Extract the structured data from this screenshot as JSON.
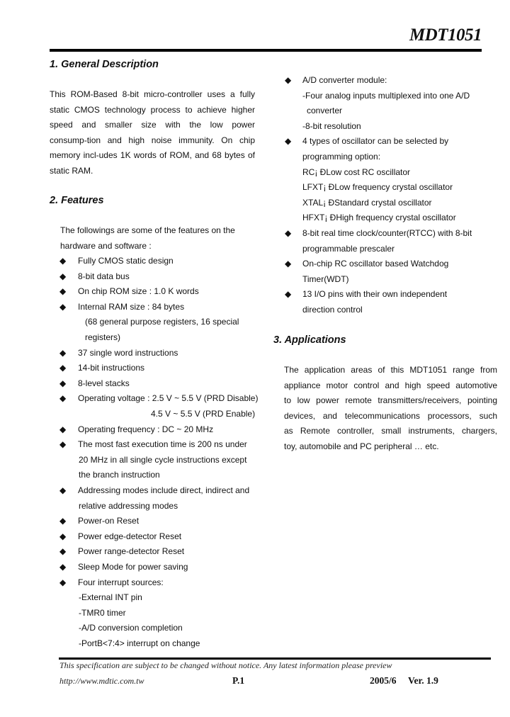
{
  "header": {
    "title": "MDT1051"
  },
  "sections": {
    "general": {
      "heading": "1. General Description",
      "lines": [
        "This ROM-Based 8-bit micro-controller uses a fully",
        "static CMOS technology process to achieve higher",
        "speed and smaller size with the low power",
        "consump-tion and high noise immunity. On chip",
        "memory incl-udes 1K words of ROM, and 68 bytes of",
        "static RAM."
      ]
    },
    "features": {
      "heading": "2. Features",
      "intro": [
        "The followings are some of the features on the",
        "hardware and software :"
      ],
      "bullet_glyph": "◆",
      "left_rows": [
        {
          "bullet": true,
          "text": "Fully CMOS static design"
        },
        {
          "bullet": true,
          "text": "8-bit data bus"
        },
        {
          "bullet": true,
          "text": "On chip ROM size : 1.0 K words"
        },
        {
          "bullet": true,
          "text": "Internal RAM size : 84 bytes"
        },
        {
          "bullet": false,
          "indent": 2,
          "text": "(68 general purpose registers, 16 special"
        },
        {
          "bullet": false,
          "indent": 2,
          "text": "registers)"
        },
        {
          "bullet": true,
          "text": "37 single word instructions"
        },
        {
          "bullet": true,
          "text": "14-bit instructions"
        },
        {
          "bullet": true,
          "text": "8-level stacks"
        },
        {
          "bullet": true,
          "text": "Operating voltage : 2.5 V ~ 5.5 V (PRD Disable)"
        },
        {
          "bullet": false,
          "indent": 3,
          "text": "4.5 V ~ 5.5 V (PRD Enable)"
        },
        {
          "bullet": true,
          "text": "Operating frequency : DC ~ 20 MHz"
        },
        {
          "bullet": true,
          "text": "The most fast execution time is 200 ns under"
        },
        {
          "bullet": false,
          "indent": 1,
          "text": "20 MHz in all single  cycle instructions except"
        },
        {
          "bullet": false,
          "indent": 1,
          "text": "the branch instruction"
        },
        {
          "bullet": true,
          "text": "Addressing modes include direct, indirect and"
        },
        {
          "bullet": false,
          "indent": 1,
          "text": "relative addressing modes"
        },
        {
          "bullet": true,
          "text": "Power-on Reset"
        },
        {
          "bullet": true,
          "text": "Power edge-detector Reset"
        },
        {
          "bullet": true,
          "text": "Power range-detector Reset"
        },
        {
          "bullet": true,
          "text": "Sleep Mode for power saving"
        },
        {
          "bullet": true,
          "text": "Four interrupt sources:"
        },
        {
          "bullet": false,
          "indent": 1,
          "text": "-External INT pin"
        },
        {
          "bullet": false,
          "indent": 1,
          "text": "-TMR0 timer"
        },
        {
          "bullet": false,
          "indent": 1,
          "text": "-A/D conversion completion"
        },
        {
          "bullet": false,
          "indent": 1,
          "text": "-PortB<7:4> interrupt on change"
        }
      ],
      "right_rows": [
        {
          "bullet": true,
          "text": "A/D converter module:"
        },
        {
          "bullet": false,
          "indent": 1,
          "text": "-Four analog inputs multiplexed into one A/D"
        },
        {
          "bullet": false,
          "indent": 2,
          "text": "converter"
        },
        {
          "bullet": false,
          "indent": 1,
          "text": "-8-bit resolution"
        },
        {
          "bullet": true,
          "text": "4 types of oscillator can be selected by"
        },
        {
          "bullet": false,
          "indent": 1,
          "text": "programming option:"
        },
        {
          "bullet": false,
          "indent": 0,
          "text": "RC¡ ÐLow cost RC oscillator"
        },
        {
          "bullet": false,
          "indent": 0,
          "text": "LFXT¡ ÐLow frequency crystal oscillator"
        },
        {
          "bullet": false,
          "indent": 0,
          "text": "XTAL¡ ÐStandard crystal oscillator"
        },
        {
          "bullet": false,
          "indent": 0,
          "text": "HFXT¡ ÐHigh frequency crystal oscillator"
        },
        {
          "bullet": true,
          "text": "8-bit real time clock/counter(RTCC) with 8-bit"
        },
        {
          "bullet": false,
          "indent": 1,
          "text": "programmable prescaler"
        },
        {
          "bullet": true,
          "text": "On-chip RC oscillator based Watchdog"
        },
        {
          "bullet": false,
          "indent": 1,
          "text": "Timer(WDT)"
        },
        {
          "bullet": true,
          "text": "13 I/O pins with their own independent"
        },
        {
          "bullet": false,
          "indent": 1,
          "text": "direction control"
        }
      ]
    },
    "applications": {
      "heading": "3. Applications",
      "lines": [
        "The application areas of this MDT1051 range from",
        "appliance motor control and high speed automotive",
        "to low power remote transmitters/receivers, pointing",
        "devices, and telecommunications processors, such",
        "as Remote controller, small instruments, chargers,",
        "toy, automobile and PC peripheral … etc."
      ]
    }
  },
  "footer": {
    "notice": "This specification are subject to be changed without notice. Any latest information  please preview",
    "url": "http://www.mdtic.com.tw",
    "page": "P.1",
    "date": "2005/6",
    "version": "Ver. 1.9"
  }
}
